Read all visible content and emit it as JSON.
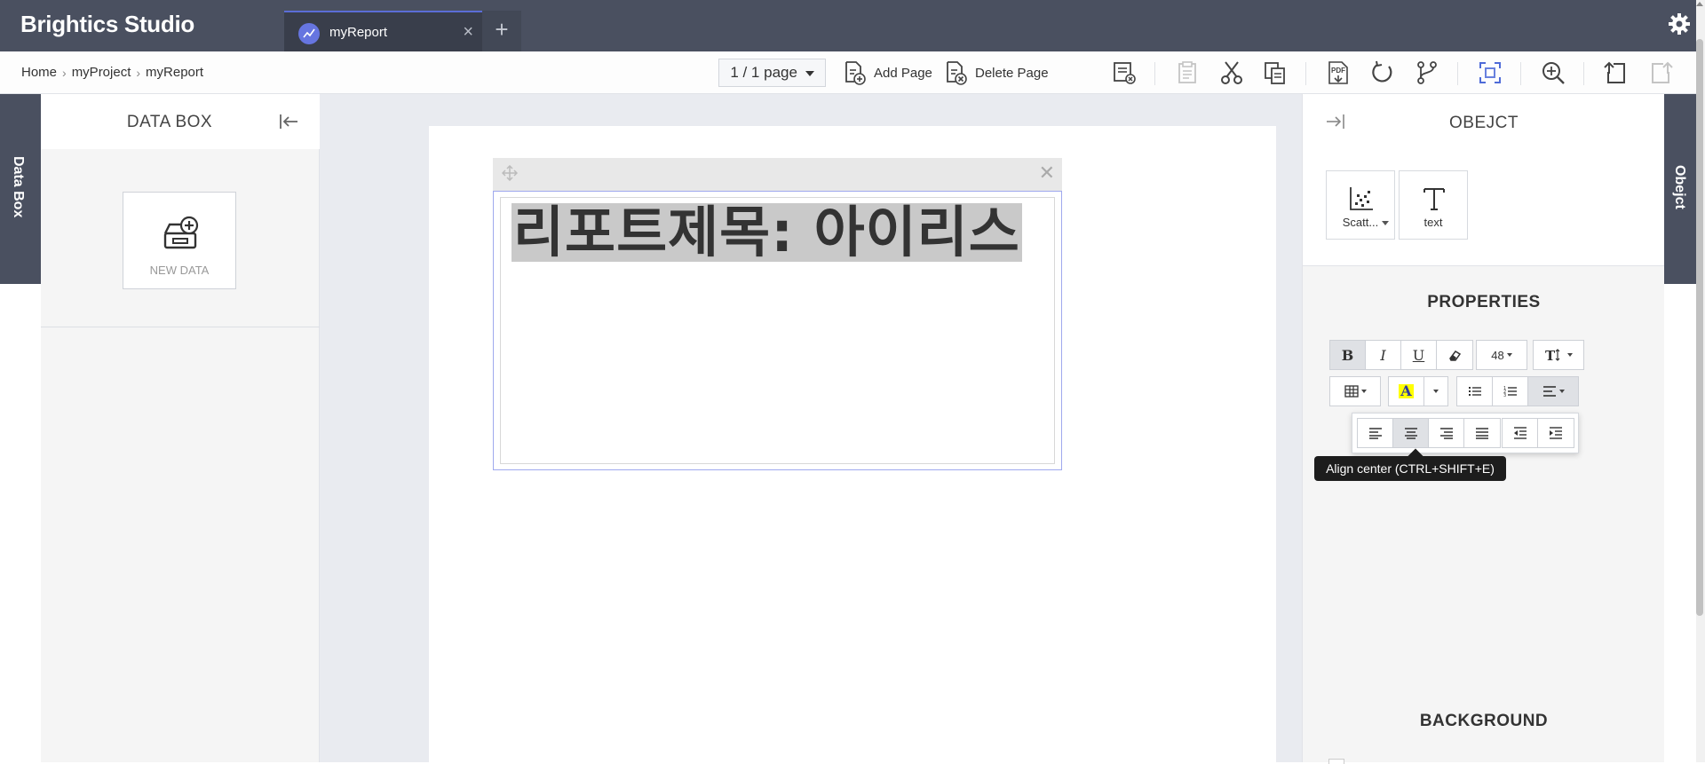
{
  "app": {
    "logo": "Brightics Studio"
  },
  "tabs": [
    {
      "label": "myReport",
      "close": "×"
    }
  ],
  "tab_add": "+",
  "breadcrumb": [
    "Home",
    "myProject",
    "myReport"
  ],
  "toolbar": {
    "page_selector": "1 / 1 page",
    "add_page": "Add Page",
    "delete_page": "Delete Page"
  },
  "left_edge_tab": "Data Box",
  "right_edge_tab": "Obejct",
  "databox": {
    "title": "DATA BOX",
    "new_data": "NEW DATA"
  },
  "report": {
    "title_text": "리포트제목: 아이리스"
  },
  "object_panel": {
    "title": "OBEJCT",
    "items": [
      {
        "label": "Scatt...",
        "icon": "scatter-chart-icon"
      },
      {
        "label": "text",
        "icon": "text-icon"
      }
    ]
  },
  "properties": {
    "title": "PROPERTIES",
    "bold": "B",
    "italic": "I",
    "underline": "U",
    "font_size": "48",
    "font_color_letter": "A",
    "highlight_color": "#ffff00"
  },
  "tooltip": "Align center (CTRL+SHIFT+E)",
  "background": {
    "title": "BACKGROUND"
  },
  "colors": {
    "topbar": "#4a5060",
    "accent": "#5b6dd6"
  }
}
